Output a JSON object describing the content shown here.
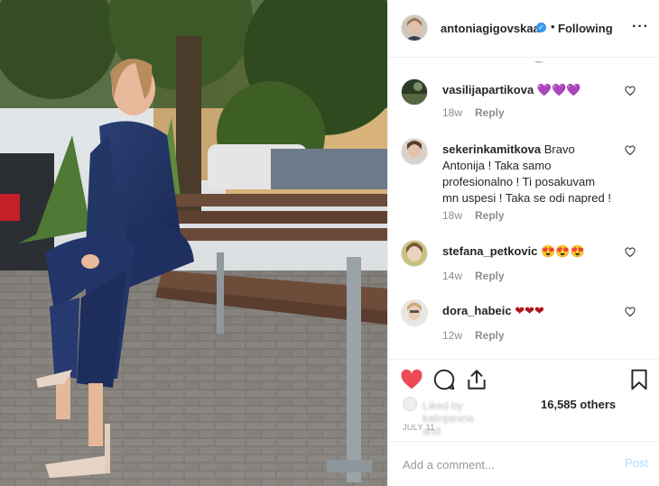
{
  "header": {
    "username": "antoniagigovskaa",
    "dot": "•",
    "follow_status": "Following",
    "more_icon": "ellipsis-icon",
    "verified_icon": "verified-badge-icon"
  },
  "comments": [
    {
      "user": "vasilijapartikova",
      "text": "💜💜💜",
      "age": "18w",
      "reply": "Reply"
    },
    {
      "user": "sekerinkamitkova",
      "text": "Bravo Antonija ! Taka samo profesionalno ! Ti posakuvam mn uspesi ! Taka se odi napred !",
      "age": "18w",
      "reply": "Reply"
    },
    {
      "user": "stefana_petkovic",
      "text": "😍😍😍",
      "age": "14w",
      "reply": "Reply"
    },
    {
      "user": "dora_habeic",
      "text": "❤❤❤",
      "age": "12w",
      "reply": "Reply"
    }
  ],
  "actions": {
    "like_icon": "heart-filled-icon",
    "comment_icon": "comment-icon",
    "share_icon": "share-icon",
    "save_icon": "bookmark-icon"
  },
  "likes": {
    "covered_text": "Liked by kalinjanina and",
    "count_text": "16,585 others"
  },
  "date": "JULY 11",
  "add_comment": {
    "placeholder": "Add a comment...",
    "post_label": "Post"
  },
  "colors": {
    "like_red": "#ed4956",
    "verified_blue": "#3897f0",
    "post_disabled": "#b2dffc",
    "muted": "#8e8e8e"
  }
}
